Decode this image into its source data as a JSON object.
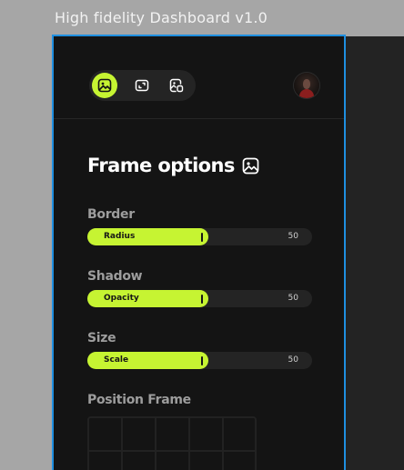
{
  "canvas": {
    "frame_label": "High fidelity Dashboard v1.0"
  },
  "toolbar": {
    "tools": [
      {
        "icon": "image-icon",
        "active": true
      },
      {
        "icon": "expand-frame-icon",
        "active": false
      },
      {
        "icon": "image-crop-icon",
        "active": false
      }
    ]
  },
  "colors": {
    "accent": "#c6f432",
    "panel_bg": "#141414",
    "track_bg": "#242424",
    "selection_border": "#1f8fe0"
  },
  "panel": {
    "title": "Frame options",
    "title_icon": "image-icon"
  },
  "sections": [
    {
      "label": "Border",
      "control": "Radius",
      "value": "50",
      "fraction": 0.54
    },
    {
      "label": "Shadow",
      "control": "Opacity",
      "value": "50",
      "fraction": 0.54
    },
    {
      "label": "Size",
      "control": "Scale",
      "value": "50",
      "fraction": 0.54
    }
  ],
  "position": {
    "label": "Position Frame",
    "columns": 5
  }
}
